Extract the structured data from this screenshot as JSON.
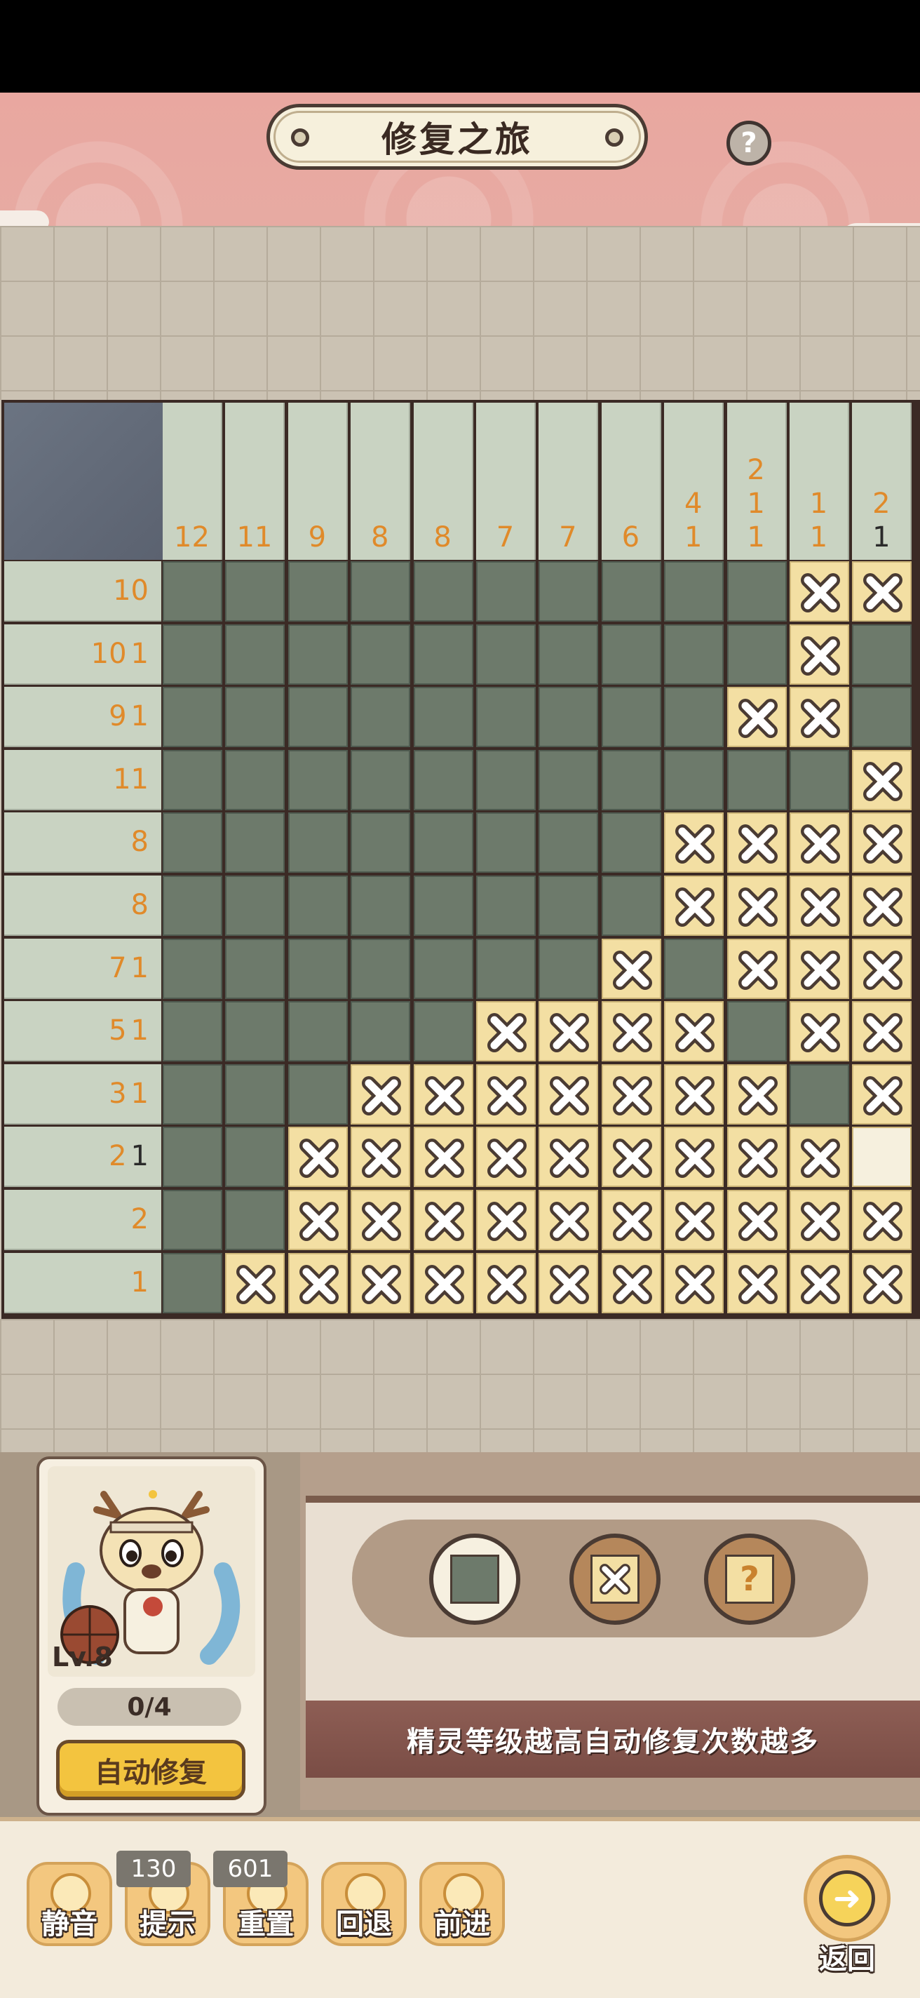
{
  "title": "修复之旅",
  "help_label": "?",
  "col_clues": [
    [
      "12"
    ],
    [
      "11"
    ],
    [
      "9"
    ],
    [
      "8"
    ],
    [
      "8"
    ],
    [
      "7"
    ],
    [
      "7"
    ],
    [
      "6"
    ],
    [
      "4",
      "1"
    ],
    [
      "2",
      "1",
      "1"
    ],
    [
      "1",
      "1"
    ],
    [
      "2",
      "1"
    ]
  ],
  "col_clue_done": [
    [
      false
    ],
    [
      false
    ],
    [
      false
    ],
    [
      false
    ],
    [
      false
    ],
    [
      false
    ],
    [
      false
    ],
    [
      false
    ],
    [
      false,
      false
    ],
    [
      false,
      false,
      false
    ],
    [
      false,
      false
    ],
    [
      false,
      true
    ]
  ],
  "row_clues": [
    [
      "10"
    ],
    [
      "10",
      "1"
    ],
    [
      "9",
      "1"
    ],
    [
      "11"
    ],
    [
      "8"
    ],
    [
      "8"
    ],
    [
      "7",
      "1"
    ],
    [
      "5",
      "1"
    ],
    [
      "3",
      "1"
    ],
    [
      "2",
      "1"
    ],
    [
      "2"
    ],
    [
      "1"
    ]
  ],
  "row_clue_done": [
    [
      false
    ],
    [
      false,
      false
    ],
    [
      false,
      false
    ],
    [
      false
    ],
    [
      false
    ],
    [
      false
    ],
    [
      false,
      false
    ],
    [
      false,
      false
    ],
    [
      false,
      false
    ],
    [
      false,
      true
    ],
    [
      false
    ],
    [
      false
    ]
  ],
  "grid": [
    "FFFFFFFFFFXX",
    "FFFFFFFFFFXF",
    "FFFFFFFFFXXF",
    "FFFFFFFFFFFX",
    "FFFFFFFFXXXX",
    "FFFFFFFFXXXX",
    "FFFFFFFXFXXX",
    "FFFFFXXXXFXX",
    "FFFXXXXXXXFX",
    "FFXXXXXXXXXE",
    "FFXXXXXXXXXX",
    "FXXXXXXXXXXX"
  ],
  "fairy": {
    "level": "Lv.8",
    "progress": "0/4",
    "auto_repair_label": "自动修复"
  },
  "tools": {
    "fill": "fill-tool",
    "cross": "cross-tool",
    "mark": "?"
  },
  "tip": "精灵等级越高自动修复次数越多",
  "toolbar": {
    "mute": "静音",
    "hint": "提示",
    "hint_count": "130",
    "reset": "重置",
    "reset_count": "601",
    "undo": "回退",
    "redo": "前进",
    "back": "返回"
  },
  "colors": {
    "filled": "#6d7a6b",
    "crossed": "#f3dfa3",
    "clue": "#e08a2a",
    "clue_done": "#2a2a2a",
    "header": "#e9a7a0"
  }
}
